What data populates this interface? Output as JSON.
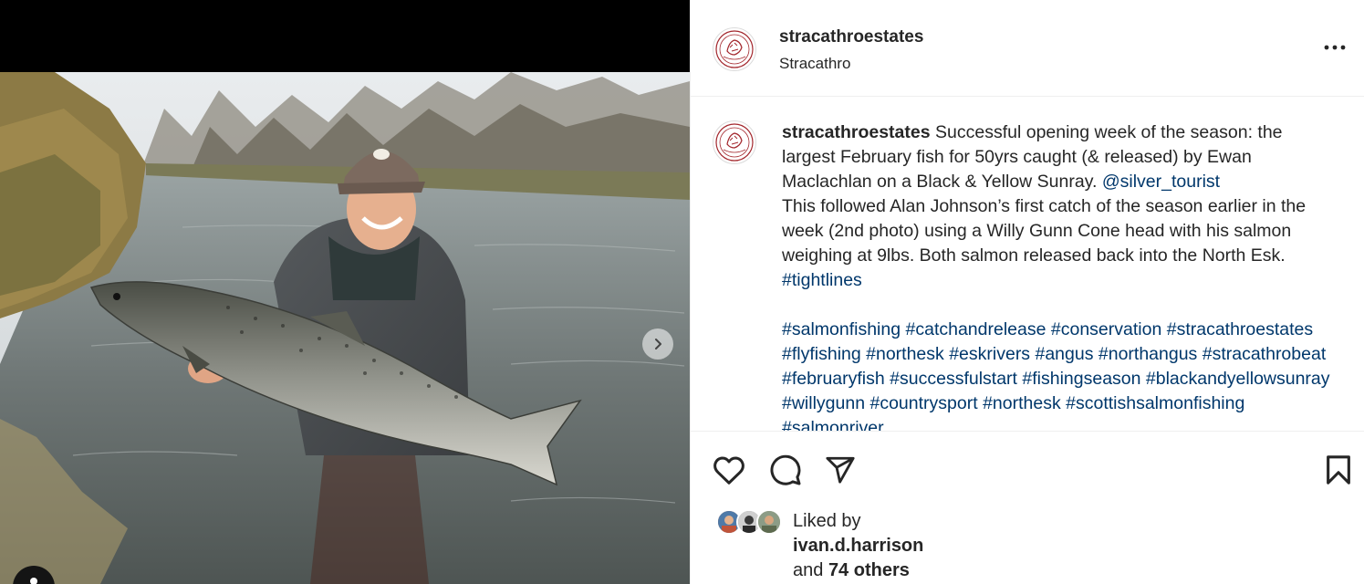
{
  "post": {
    "username": "stracathroestates",
    "location": "Stracathro",
    "more_icon": "more-horizontal-icon"
  },
  "caption": {
    "username": "stracathroestates",
    "text_1": " Successful opening week of the season: the largest February fish for 50yrs caught (& released) by Ewan Maclachlan on a Black & Yellow Sunray. ",
    "mention": "@silver_tourist",
    "text_2": "\nThis followed Alan Johnson’s first catch of the season earlier in the week (2nd photo) using a Willy Gunn Cone head with his salmon weighing at 9lbs. Both salmon released back into the North Esk. ",
    "tag_tightlines": "#tightlines",
    "hashtags": [
      "#salmonfishing",
      "#catchandrelease",
      "#conservation",
      "#stracathroestates",
      "#flyfishing",
      "#northesk",
      "#eskrivers",
      "#angus",
      "#northangus",
      "#stracathrobeat",
      "#februaryfish",
      "#successfulstart",
      "#fishingseason",
      "#blackandyellowsunray",
      "#willygunn",
      "#countrysport",
      "#northesk",
      "#scottishsalmonfishing",
      "#salmonriver"
    ]
  },
  "actions": {
    "like_icon": "heart-icon",
    "comment_icon": "comment-icon",
    "share_icon": "send-icon",
    "save_icon": "bookmark-icon"
  },
  "likes": {
    "prefix": "Liked by",
    "user": "ivan.d.harrison",
    "and": "and",
    "others": "74 others"
  },
  "media": {
    "next_icon": "chevron-right-icon",
    "tag_icon": "user-tag-icon"
  }
}
